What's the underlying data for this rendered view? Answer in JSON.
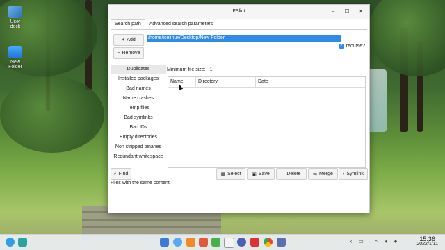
{
  "desktop": {
    "icons": [
      {
        "label": "User\ndock"
      },
      {
        "label": "New\nFolder"
      }
    ]
  },
  "window": {
    "title": "FSlint",
    "controls": {
      "minimize": "–",
      "maximize": "☐",
      "close": "✕"
    }
  },
  "tabs": [
    "Search path",
    "Advanced search parameters"
  ],
  "search_path": {
    "add_label": "Add",
    "remove_label": "Remove",
    "path": "/home/icelinux/Desktop/New Folder",
    "recurse_label": "recurse?",
    "recurse_checked": true
  },
  "sidebar": {
    "items": [
      {
        "label": "Duplicates"
      },
      {
        "label": "Installed packages"
      },
      {
        "label": "Bad names"
      },
      {
        "label": "Name clashes"
      },
      {
        "label": "Temp files"
      },
      {
        "label": "Bad symlinks"
      },
      {
        "label": "Bad IDs"
      },
      {
        "label": "Empty directories"
      },
      {
        "label": "Non stripped binaries"
      },
      {
        "label": "Redundant whitespace"
      }
    ],
    "find_label": "Find"
  },
  "main": {
    "min_size_label": "Minimum file size:",
    "min_size_value": "1",
    "columns": [
      "Name",
      "Directory",
      "Date"
    ],
    "actions": {
      "select": "Select",
      "save": "Save",
      "delete": "Delete",
      "merge": "Merge",
      "symlink": "Symlink"
    }
  },
  "status_text": "Files with the same content",
  "taskbar": {
    "time": "15:36",
    "date": "2022/1/11"
  }
}
